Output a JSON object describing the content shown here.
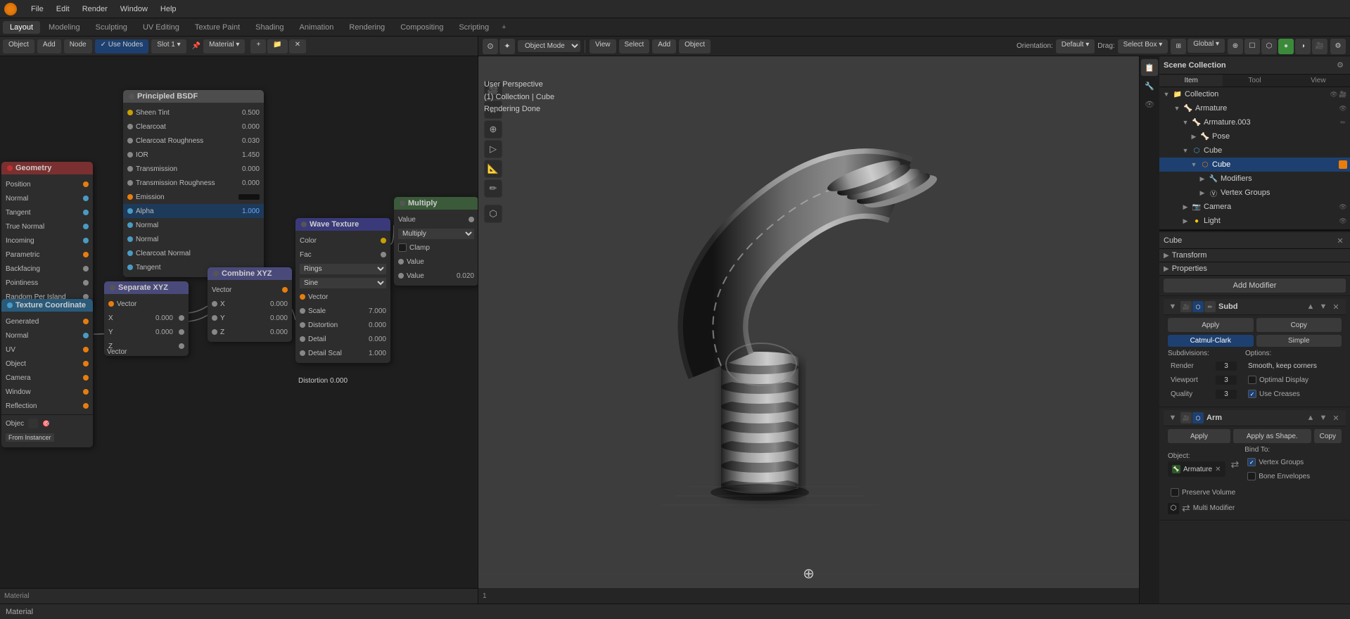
{
  "app": {
    "title": "Blender",
    "logo_color": "#e87d0d"
  },
  "top_menu": {
    "items": [
      "File",
      "Edit",
      "Render",
      "Window",
      "Help"
    ]
  },
  "workspace_tabs": {
    "items": [
      "Layout",
      "Modeling",
      "Sculpting",
      "UV Editing",
      "Texture Paint",
      "Shading",
      "Animation",
      "Rendering",
      "Compositing",
      "Scripting"
    ],
    "active": "Layout",
    "add_label": "+"
  },
  "node_editor": {
    "header": {
      "editor_type": "Material",
      "slot": "Slot 1",
      "material": "Material",
      "use_nodes": true
    },
    "nodes": {
      "sheen_node": {
        "title": "",
        "rows": [
          {
            "label": "Sheen Tint",
            "value": "0.500",
            "socket_color": "yellow"
          },
          {
            "label": "Clearcoat",
            "value": "0.000",
            "socket_color": "gray"
          },
          {
            "label": "Clearcoat Roughness",
            "value": "0.030",
            "socket_color": "gray"
          },
          {
            "label": "IOR",
            "value": "1.450",
            "socket_color": "gray"
          },
          {
            "label": "Transmission",
            "value": "0.000",
            "socket_color": "gray"
          },
          {
            "label": "Transmission Roughness",
            "value": "0.000",
            "socket_color": "gray"
          },
          {
            "label": "Emission",
            "value": "",
            "socket_color": "orange"
          },
          {
            "label": "Alpha",
            "value": "1.000",
            "socket_color": "blue",
            "highlight": "blue"
          },
          {
            "label": "Normal",
            "value": "",
            "socket_color": "blue"
          },
          {
            "label": "Normal",
            "value": "",
            "socket_color": "blue"
          },
          {
            "label": "Clearcoat Normal",
            "value": "",
            "socket_color": "blue"
          },
          {
            "label": "Tangent",
            "value": "",
            "socket_color": "blue"
          }
        ]
      },
      "geometry_node": {
        "title": "Geometry",
        "rows": [
          {
            "label": "Position",
            "socket": "right",
            "socket_color": "orange"
          },
          {
            "label": "Normal",
            "socket": "right",
            "socket_color": "blue"
          },
          {
            "label": "Tangent",
            "socket": "right",
            "socket_color": "blue"
          },
          {
            "label": "True Normal",
            "socket": "right",
            "socket_color": "blue"
          },
          {
            "label": "Incoming",
            "socket": "right",
            "socket_color": "blue"
          },
          {
            "label": "Parametric",
            "socket": "right",
            "socket_color": "orange"
          },
          {
            "label": "Backfacing",
            "socket": "right",
            "socket_color": "gray"
          },
          {
            "label": "Pointiness",
            "socket": "right",
            "socket_color": "gray"
          },
          {
            "label": "Random Per Island",
            "socket": "right",
            "socket_color": "gray"
          }
        ]
      },
      "texture_coord_node": {
        "title": "Texture Coordinate",
        "rows": [
          {
            "label": "Generated",
            "socket_color": "orange"
          },
          {
            "label": "Normal",
            "socket_color": "blue"
          },
          {
            "label": "UV",
            "socket_color": "orange"
          },
          {
            "label": "Object",
            "socket_color": "orange"
          },
          {
            "label": "Camera",
            "socket_color": "orange"
          },
          {
            "label": "Window",
            "socket_color": "orange"
          },
          {
            "label": "Reflection",
            "socket_color": "orange"
          }
        ],
        "bottom_row": {
          "label": "Objec",
          "button": "From Instancer"
        }
      },
      "separate_xyz_node": {
        "title": "Separate XYZ",
        "rows": [
          {
            "label": "Vector",
            "socket": "left"
          },
          {
            "label": "X",
            "value": "0.000",
            "socket": "right"
          },
          {
            "label": "Y",
            "value": "0.000",
            "socket": "right"
          },
          {
            "label": "Z",
            "socket": "right"
          }
        ]
      },
      "combine_xyz_node": {
        "title": "Combine XYZ",
        "rows": [
          {
            "label": "Vector",
            "socket": "right"
          },
          {
            "label": "X",
            "value": "0.000"
          },
          {
            "label": "Y",
            "value": "0.000"
          },
          {
            "label": "Z",
            "value": "0.000"
          }
        ]
      },
      "wave_texture_node": {
        "title": "Wave Texture",
        "rows": [
          {
            "label": "Color",
            "socket": "right",
            "socket_color": "yellow"
          },
          {
            "label": "Fac",
            "socket": "right",
            "socket_color": "gray"
          },
          {
            "label": "Rings",
            "type": "dropdown"
          },
          {
            "label": "Sine",
            "type": "dropdown"
          },
          {
            "label": "Vector"
          },
          {
            "label": "Scale",
            "value": "7.000"
          },
          {
            "label": "Distortion",
            "value": "0.000"
          },
          {
            "label": "Detail",
            "value": "0.000"
          },
          {
            "label": "Detail Scal",
            "value": "1.000"
          }
        ]
      },
      "multiply_node": {
        "title": "Multiply",
        "rows": [
          {
            "label": "Value",
            "socket": "right"
          },
          {
            "label": "Multiply",
            "type": "dropdown"
          },
          {
            "label": "Clamp",
            "type": "checkbox"
          },
          {
            "label": "Value"
          },
          {
            "label": "Value",
            "value": "0.020"
          }
        ]
      }
    }
  },
  "viewport": {
    "header": {
      "mode": "Object Mode",
      "view_label": "View",
      "select_label": "Select",
      "add_label": "Add",
      "object_label": "Object"
    },
    "info": {
      "perspective": "User Perspective",
      "collection": "(1) Collection | Cube",
      "status": "Rendering Done"
    },
    "orientation": "Default",
    "drag": "Select Box",
    "transform": "Global"
  },
  "scene_collection": {
    "title": "Scene Collection",
    "items_label": "Items",
    "tool_label": "Tool",
    "view_label": "View",
    "tree": [
      {
        "label": "Collection",
        "icon": "collection",
        "indent": 0,
        "type": "collection"
      },
      {
        "label": "Armature",
        "icon": "armature",
        "indent": 1,
        "type": "armature"
      },
      {
        "label": "Armature.003",
        "icon": "armature",
        "indent": 2,
        "type": "armature"
      },
      {
        "label": "Pose",
        "icon": "pose",
        "indent": 3,
        "type": "pose"
      },
      {
        "label": "Cube",
        "icon": "mesh",
        "indent": 2,
        "type": "object"
      },
      {
        "label": "Cube",
        "icon": "mesh",
        "indent": 3,
        "type": "object",
        "selected": true
      },
      {
        "label": "Modifiers",
        "icon": "modifier",
        "indent": 4,
        "type": "modifier"
      },
      {
        "label": "Vertex Groups",
        "icon": "vertex",
        "indent": 4,
        "type": "vertex"
      },
      {
        "label": "Camera",
        "icon": "camera",
        "indent": 2,
        "type": "camera"
      },
      {
        "label": "Light",
        "icon": "light",
        "indent": 2,
        "type": "light"
      }
    ]
  },
  "properties": {
    "active_object": "Cube",
    "add_modifier_label": "Add Modifier",
    "modifiers": [
      {
        "name": "Subd",
        "type": "Subdivision",
        "apply_label": "Apply",
        "copy_label": "Copy",
        "modes": [
          "Catmul-Clark",
          "Simple"
        ],
        "active_mode": "Catmul-Clark",
        "subdivisions_label": "Subdivisions:",
        "options_label": "Options:",
        "render_label": "Render",
        "render_value": "3",
        "viewport_label": "Viewport",
        "viewport_value": "3",
        "quality_label": "Quality",
        "quality_value": "3",
        "smooth_label": "Smooth, keep corners",
        "optimal_display_label": "Optimal Display",
        "use_creases_label": "Use Creases"
      },
      {
        "name": "Arm",
        "type": "Armature",
        "apply_label": "Apply",
        "apply_as_shape_label": "Apply as Shape.",
        "copy_label": "Copy",
        "object_label": "Object:",
        "object_value": "Armature",
        "bind_to_label": "Bind To:",
        "vertex_groups_label": "Vertex Groups",
        "preserve_volume_label": "Preserve Volume",
        "bone_envelopes_label": "Bone Envelopes",
        "multi_modifier_label": "Multi Modifier"
      }
    ]
  },
  "status_bar": {
    "left_text": "Material",
    "help_text": ""
  },
  "icons": {
    "chevron_right": "▶",
    "chevron_down": "▼",
    "checkmark": "✓",
    "mesh": "⬡",
    "camera": "📷",
    "light": "💡",
    "armature": "🦴",
    "collection": "📁",
    "add": "+",
    "close": "✕",
    "eye": "👁",
    "render": "🎥",
    "modifier": "🔧",
    "socket": "●",
    "link": "🔗"
  }
}
